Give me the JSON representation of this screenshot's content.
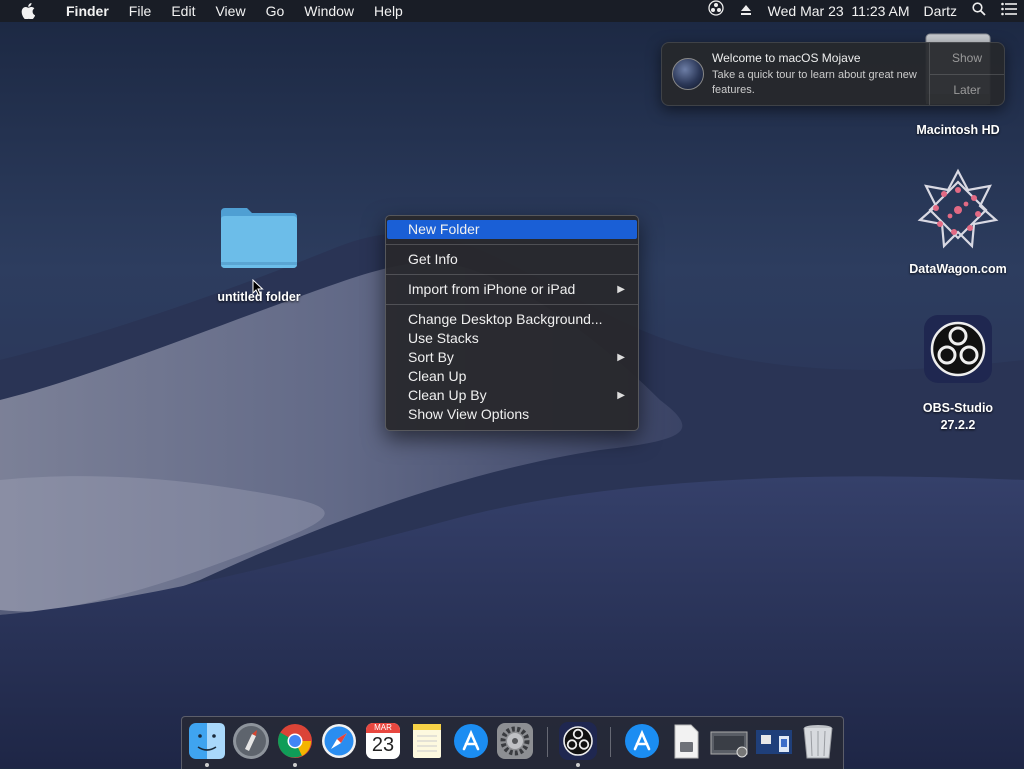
{
  "menubar": {
    "app_name": "Finder",
    "menus": [
      "File",
      "Edit",
      "View",
      "Go",
      "Window",
      "Help"
    ],
    "datetime": "Wed Mar 23  11:23 AM",
    "user": "Dartz",
    "icons": [
      "apple-icon",
      "obs-status-icon",
      "eject-icon",
      "spotlight-search-icon",
      "notification-center-icon"
    ]
  },
  "notification": {
    "title": "Welcome to macOS Mojave",
    "body": "Take a quick tour to learn about great new features.",
    "show_label": "Show",
    "later_label": "Later"
  },
  "desktop": {
    "folder_label": "untitled folder",
    "drive_label": "Macintosh HD",
    "datawagon_label": "DataWagon.com",
    "obs_label_line1": "OBS-Studio",
    "obs_label_line2": "27.2.2"
  },
  "context_menu": {
    "new_folder": "New Folder",
    "get_info": "Get Info",
    "import": "Import from iPhone or iPad",
    "change_bg": "Change Desktop Background...",
    "use_stacks": "Use Stacks",
    "sort_by": "Sort By",
    "clean_up": "Clean Up",
    "clean_up_by": "Clean Up By",
    "show_view_options": "Show View Options"
  },
  "dock": {
    "calendar_month": "MAR",
    "calendar_day": "23",
    "apps": [
      "Finder",
      "Launchpad",
      "Chrome",
      "Safari",
      "Calendar",
      "Notes",
      "App Store",
      "System Preferences",
      "OBS",
      "App Store Downloads",
      "Document",
      "Screenshots",
      "Preview Stack",
      "Trash"
    ]
  },
  "colors": {
    "selection": "#1a5fd6",
    "folder": "#62b6e8"
  }
}
